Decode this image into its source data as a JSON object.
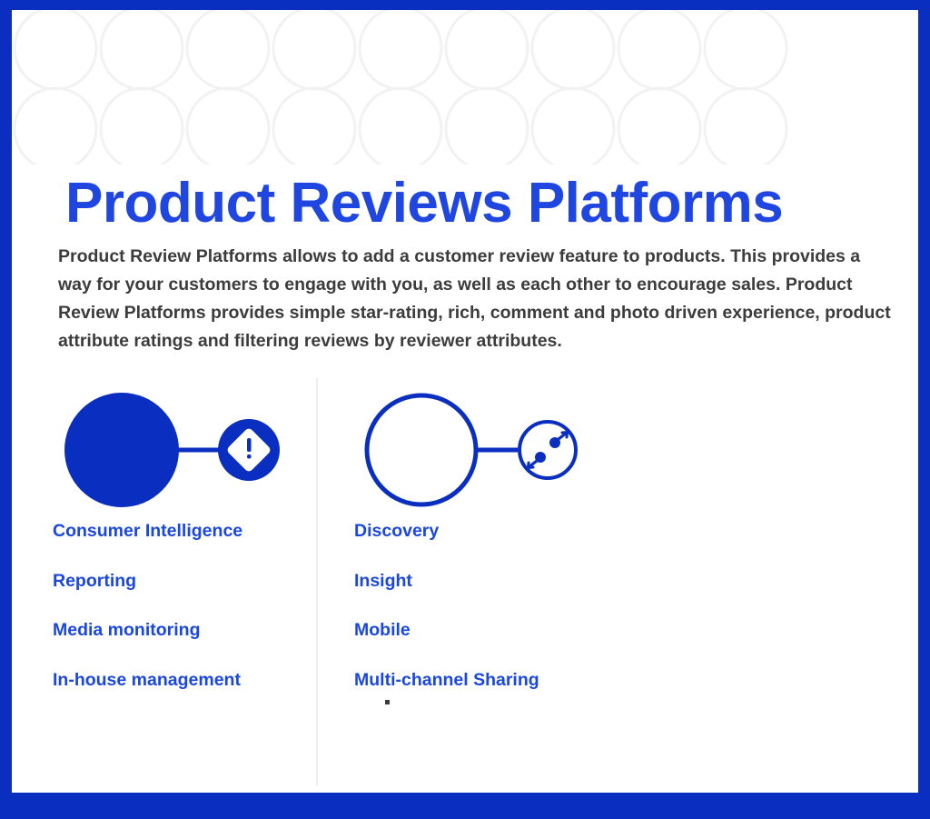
{
  "slide": {
    "title": "Product Reviews Platforms",
    "body": "Product Review Platforms allows to add a customer review feature to products. This provides a way for your customers to engage with you, as well as each other to encourage sales. Product Review Platforms provides simple star-rating, rich, comment and photo driven experience, product attribute ratings and filtering reviews by reviewer attributes.",
    "colors": {
      "frame_blue": "#0a2fc0",
      "title_blue": "#1f46e0",
      "label_blue": "#1a47dd",
      "icon_blue": "#0a2fc0",
      "body_gray": "#3c3c3c",
      "divider_gray": "#ededed",
      "pattern_gray": "#f2f2f2"
    }
  },
  "columns": [
    {
      "id": "left",
      "icon_large": "filled-circle",
      "icon_small": "alert-diamond-icon",
      "items": [
        {
          "label": "Consumer Intelligence"
        },
        {
          "label": "Reporting"
        },
        {
          "label": "Media monitoring"
        },
        {
          "label": "In-house management"
        }
      ]
    },
    {
      "id": "right",
      "icon_large": "outline-circle",
      "icon_small": "expand-arrows-icon",
      "items": [
        {
          "label": "Discovery"
        },
        {
          "label": "Insight"
        },
        {
          "label": "Mobile"
        },
        {
          "label": "Multi-channel Sharing"
        }
      ]
    }
  ],
  "decoration": {
    "bullet_dot": "•"
  }
}
